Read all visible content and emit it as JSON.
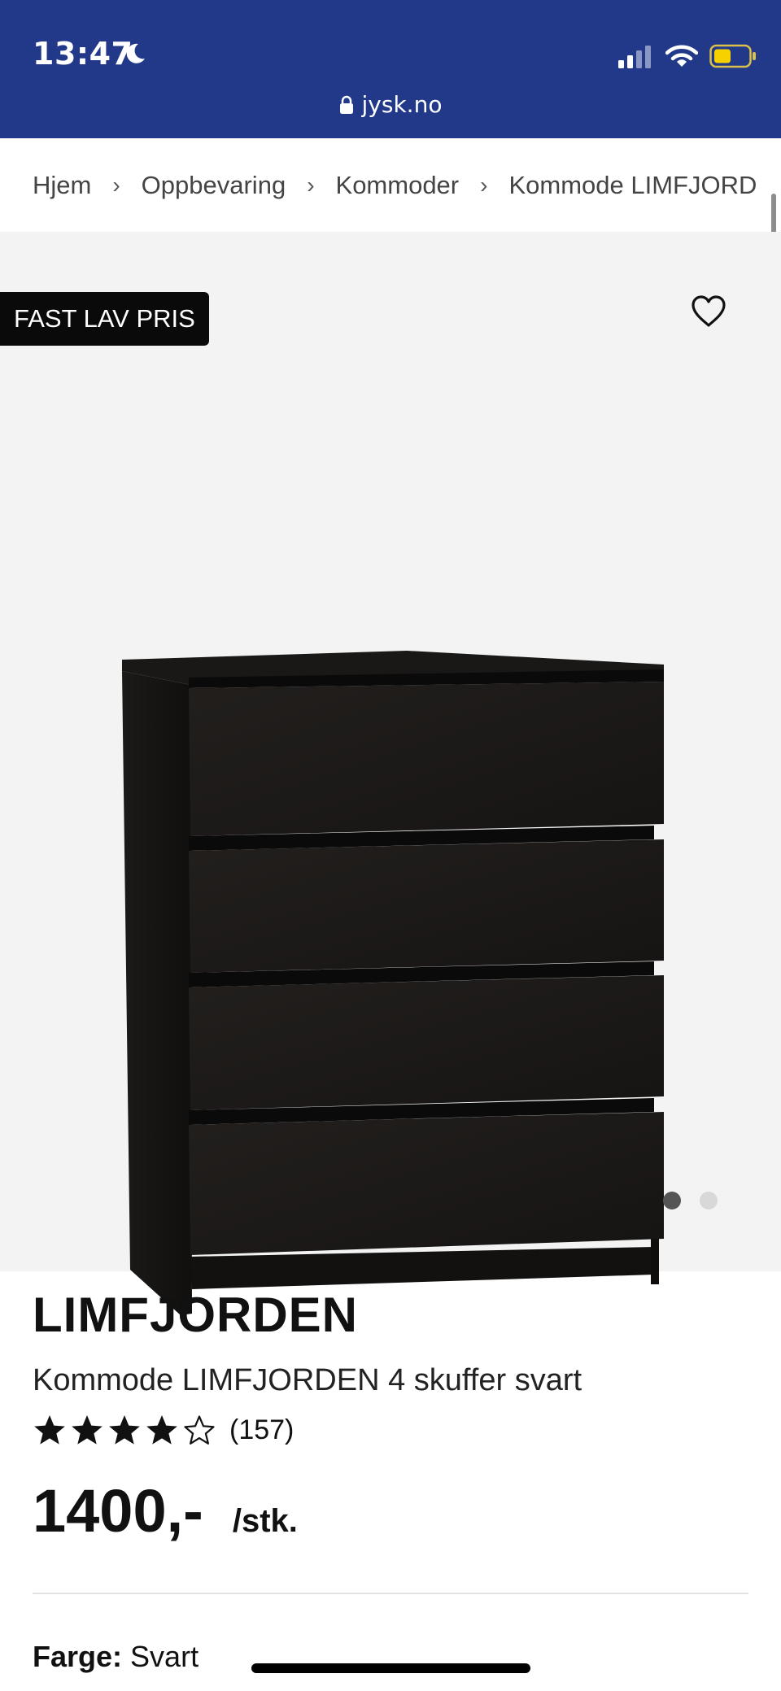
{
  "status_bar": {
    "time": "13:47"
  },
  "browser": {
    "url": "jysk.no"
  },
  "breadcrumb": {
    "items": [
      "Hjem",
      "Oppbevaring",
      "Kommoder",
      "Kommode LIMFJORD"
    ],
    "separator": "›"
  },
  "gallery": {
    "badge": "FAST LAV PRIS",
    "image_count": 2,
    "active_index": 0
  },
  "product": {
    "brand": "LIMFJORDEN",
    "name": "Kommode LIMFJORDEN 4 skuffer svart",
    "rating": 4,
    "rating_max": 5,
    "review_count": "(157)",
    "price": "1400,-",
    "unit": "/stk.",
    "color_label": "Farge:",
    "color_value": "Svart"
  },
  "colors": {
    "header_bg": "#22398a",
    "badge_bg": "#0a0a0a",
    "gallery_bg": "#f3f3f3"
  },
  "icons": [
    "moon-icon",
    "cellular-signal-icon",
    "wifi-icon",
    "battery-icon",
    "lock-icon",
    "heart-icon",
    "star-filled-icon",
    "star-outline-icon"
  ]
}
